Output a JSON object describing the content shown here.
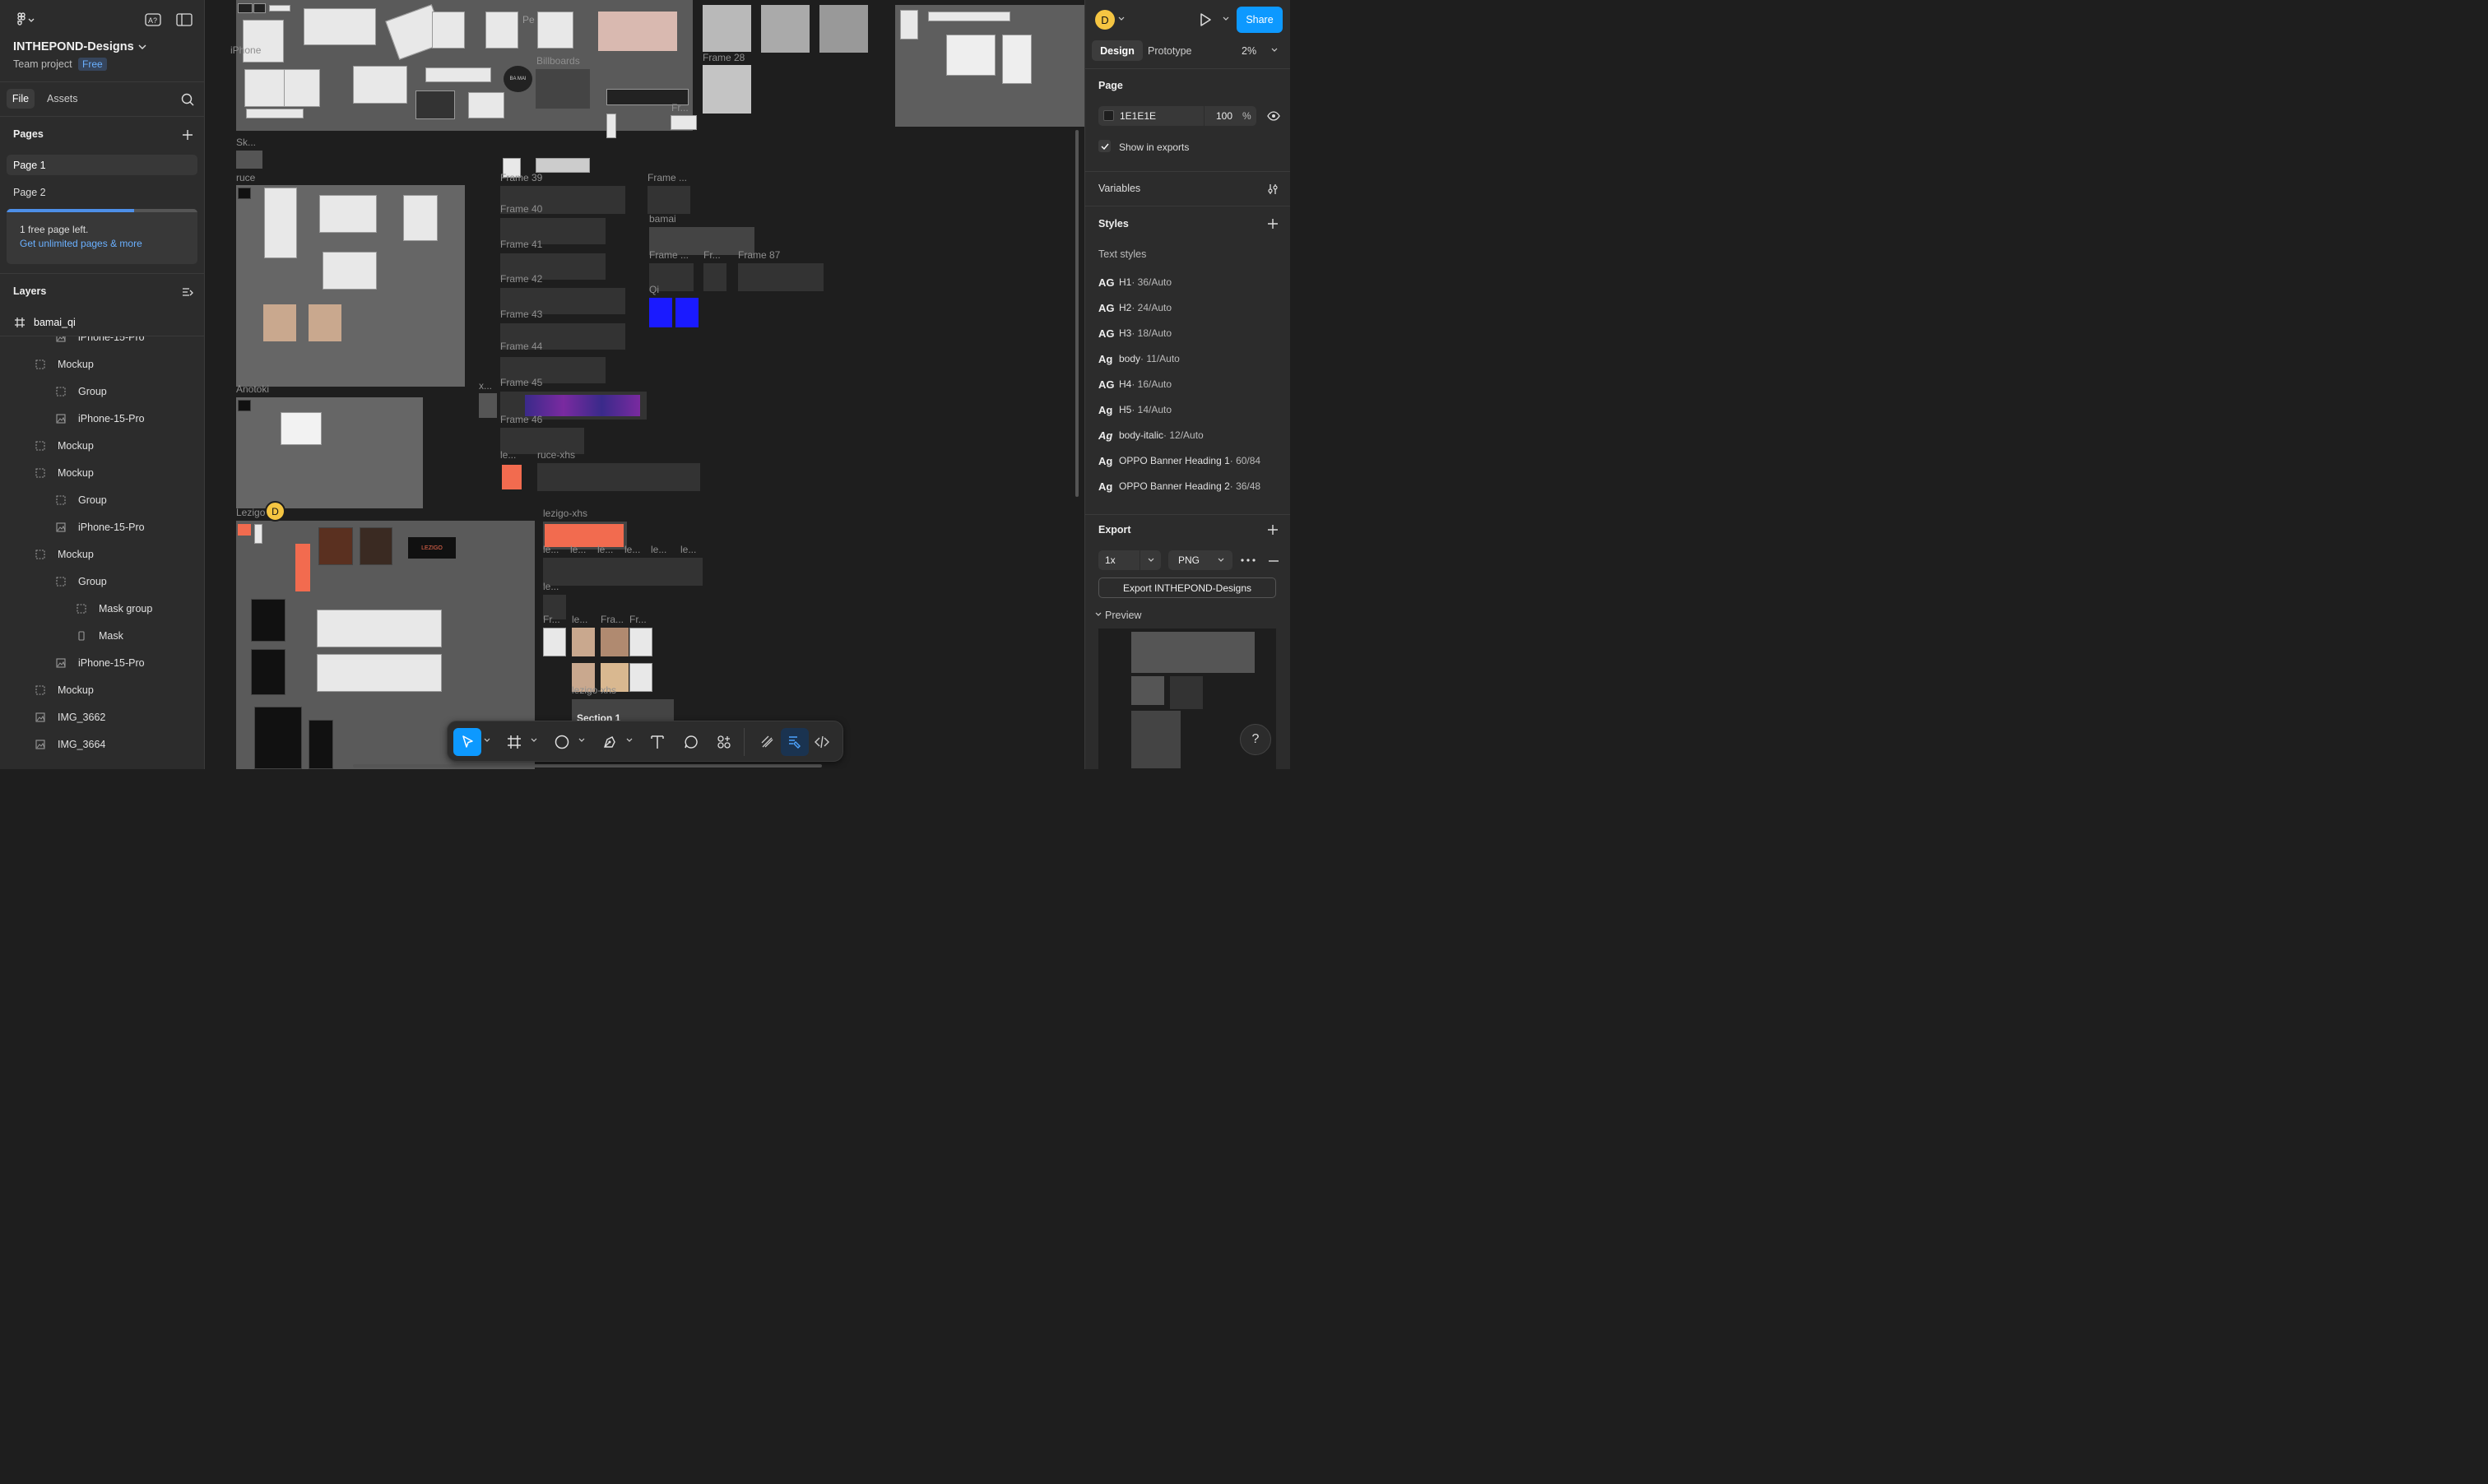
{
  "left": {
    "project_name": "INTHEPOND-Designs",
    "team_label": "Team project",
    "plan_badge": "Free",
    "tabs": [
      "File",
      "Assets"
    ],
    "pages_header": "Pages",
    "pages": [
      "Page 1",
      "Page 2"
    ],
    "upsell_text": "1 free page left.",
    "upsell_link": "Get unlimited pages & more",
    "pages_used_fraction": 0.67,
    "layers_header": "Layers",
    "selected_frame": "bamai_qi",
    "layers": [
      {
        "name": "iPhone-15-Pro",
        "type": "image",
        "indent": 2
      },
      {
        "name": "Mockup",
        "type": "group",
        "indent": 1
      },
      {
        "name": "Group",
        "type": "group",
        "indent": 2
      },
      {
        "name": "iPhone-15-Pro",
        "type": "image",
        "indent": 2
      },
      {
        "name": "Mockup",
        "type": "group",
        "indent": 1
      },
      {
        "name": "Mockup",
        "type": "group",
        "indent": 1
      },
      {
        "name": "Group",
        "type": "group",
        "indent": 2
      },
      {
        "name": "iPhone-15-Pro",
        "type": "image",
        "indent": 2
      },
      {
        "name": "Mockup",
        "type": "group",
        "indent": 1
      },
      {
        "name": "Group",
        "type": "group",
        "indent": 2
      },
      {
        "name": "Mask group",
        "type": "group",
        "indent": 3
      },
      {
        "name": "Mask",
        "type": "rect",
        "indent": 3
      },
      {
        "name": "iPhone-15-Pro",
        "type": "image",
        "indent": 2
      },
      {
        "name": "Mockup",
        "type": "group",
        "indent": 1
      },
      {
        "name": "IMG_3662",
        "type": "image",
        "indent": 1
      },
      {
        "name": "IMG_3664",
        "type": "image",
        "indent": 1
      }
    ]
  },
  "right": {
    "avatar_initial": "D",
    "share_label": "Share",
    "tabs": [
      "Design",
      "Prototype"
    ],
    "zoom": "2%",
    "page_section": "Page",
    "page_color_hex": "1E1E1E",
    "page_opacity": "100",
    "percent_sign": "%",
    "show_in_exports": "Show in exports",
    "variables": "Variables",
    "styles": "Styles",
    "text_styles_header": "Text styles",
    "text_styles": [
      {
        "ag": "AG",
        "name": "H1",
        "meta": " · 36/Auto"
      },
      {
        "ag": "AG",
        "name": "H2",
        "meta": " · 24/Auto"
      },
      {
        "ag": "AG",
        "name": "H3",
        "meta": " · 18/Auto"
      },
      {
        "ag": "Ag",
        "name": "body",
        "meta": " · 11/Auto"
      },
      {
        "ag": "AG",
        "name": "H4",
        "meta": " · 16/Auto"
      },
      {
        "ag": "Ag",
        "name": "H5",
        "meta": " · 14/Auto"
      },
      {
        "ag": "Ag",
        "name": "body-italic",
        "meta": " · 12/Auto"
      },
      {
        "ag": "Ag",
        "name": "OPPO Banner Heading 1",
        "meta": " · 60/84"
      },
      {
        "ag": "Ag",
        "name": "OPPO Banner Heading 2",
        "meta": " · 36/48"
      }
    ],
    "export_header": "Export",
    "export_scale": "1x",
    "export_format": "PNG",
    "export_button": "Export INTHEPOND-Designs",
    "preview_label": "Preview",
    "help": "?"
  },
  "canvas": {
    "labels": {
      "sk": "Sk...",
      "ruce": "ruce",
      "anotoki": "Anotoki",
      "lezigo": "Lezigo",
      "iphone": "iPhone",
      "billboards": "Billboards",
      "frame28": "Frame 28",
      "frame39": "Frame 39",
      "frame40": "Frame 40",
      "frame41": "Frame 41",
      "frame42": "Frame 42",
      "frame43": "Frame 43",
      "frame44": "Frame 44",
      "frame45": "Frame 45",
      "frame46": "Frame 46",
      "frame_dots": "Frame ...",
      "bamai": "bamai",
      "frame_dots2": "Frame ...",
      "fr_dots": "Fr...",
      "frame87": "Frame 87",
      "qi": "Qi",
      "x_dots": "x...",
      "le_dots": "le...",
      "ruce_xhs": "ruce-xhs",
      "lezigo_xhs": "lezigo-xhs",
      "le1": "le...",
      "le2": "le...",
      "le3": "le...",
      "le4": "le...",
      "le5": "le...",
      "le6": "le...",
      "le7": "le...",
      "fr1": "Fr...",
      "le8": "le...",
      "fra": "Fra...",
      "fr2": "Fr...",
      "lezigo_xhs2": "lezigo-xhs",
      "section1": "Section 1",
      "bamai_logo": "BA MAI",
      "lezigo_logo": "LEZIGO",
      "peek": "Pe",
      "cursor_initial": "D"
    }
  },
  "colors": {
    "accent": "#0d99ff",
    "avatar": "#f5c542",
    "canvas_bg": "#1e1e1e",
    "panel_bg": "#2c2c2c",
    "frame_bg": "#666666",
    "lezigo_orange": "#f26b4f",
    "qi_blue": "#1a1aff"
  },
  "toolbar": {
    "tools": [
      "move-tool",
      "frame-tool",
      "shape-tool",
      "pen-tool",
      "text-tool",
      "comment-tool",
      "actions-tool",
      "draw-mode",
      "design-mode",
      "dev-mode"
    ]
  }
}
